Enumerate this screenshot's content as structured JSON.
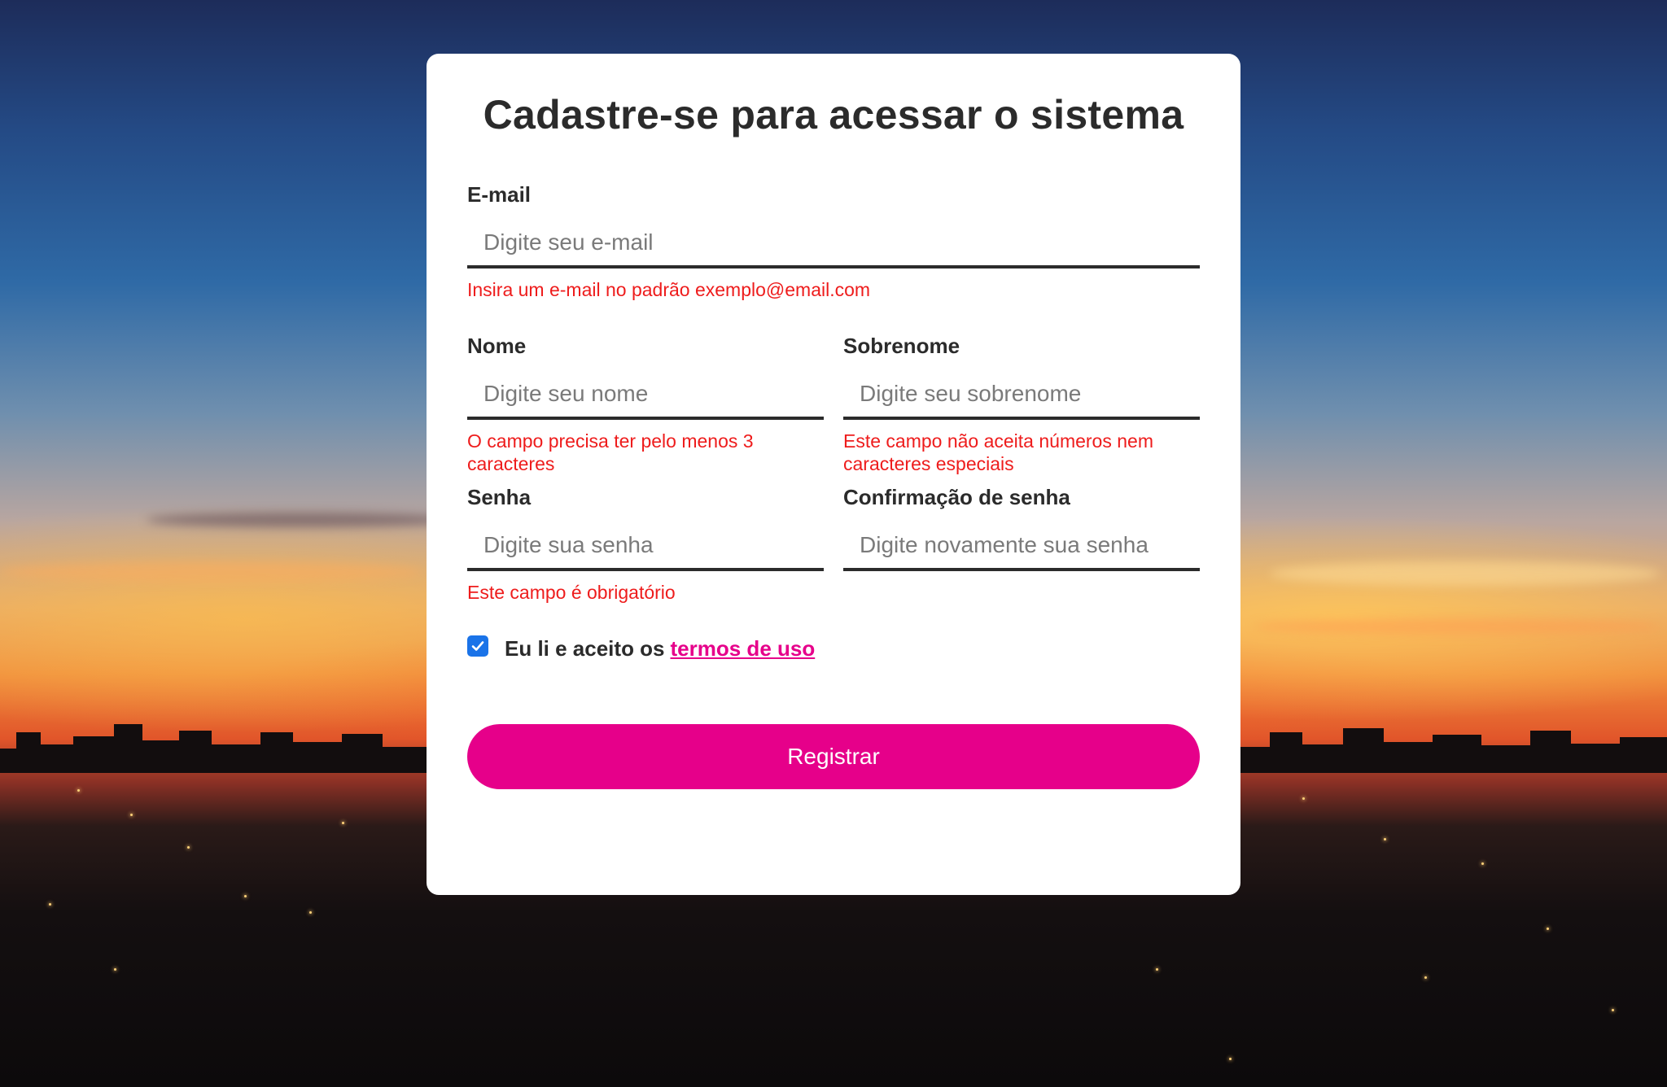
{
  "form": {
    "title": "Cadastre-se para acessar o sistema",
    "email": {
      "label": "E-mail",
      "placeholder": "Digite seu e-mail",
      "value": "",
      "error": "Insira um e-mail no padrão exemplo@email.com"
    },
    "nome": {
      "label": "Nome",
      "placeholder": "Digite seu nome",
      "value": "",
      "error": "O campo precisa ter pelo menos 3 caracteres"
    },
    "sobrenome": {
      "label": "Sobrenome",
      "placeholder": "Digite seu sobrenome",
      "value": "",
      "error": "Este campo não aceita números nem caracteres especiais"
    },
    "senha": {
      "label": "Senha",
      "placeholder": "Digite sua senha",
      "value": "",
      "error": "Este campo é obrigatório"
    },
    "confirmacao": {
      "label": "Confirmação de senha",
      "placeholder": "Digite novamente sua senha",
      "value": ""
    },
    "terms": {
      "checked": true,
      "text": "Eu li e aceito os",
      "link": "termos de uso"
    },
    "submit_label": "Registrar"
  },
  "colors": {
    "accent": "#e6008a",
    "error": "#ee1c1c",
    "text": "#2b2b2b",
    "checkbox": "#1a73e8",
    "card": "#ffffff"
  },
  "icons": {
    "checkbox": "checkmark-icon"
  }
}
